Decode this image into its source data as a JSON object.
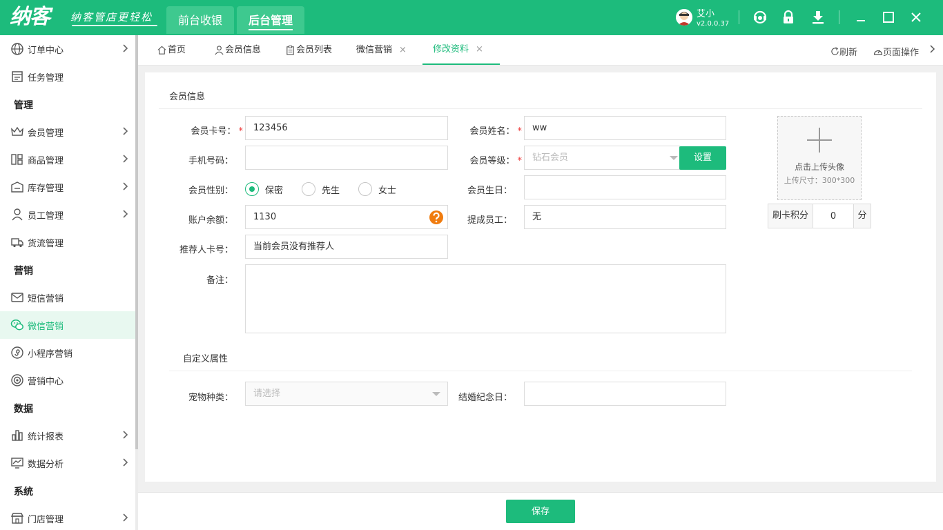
{
  "header": {
    "logo": "纳客",
    "slogan": "纳客管店更轻松",
    "tabs": [
      "前台收银",
      "后台管理"
    ],
    "user_name": "艾小",
    "version": "v2.0.0.37"
  },
  "sidebar": {
    "items": [
      {
        "label": "订单中心",
        "icon": "globe-icon",
        "arrow": true
      },
      {
        "label": "任务管理",
        "icon": "task-icon",
        "arrow": false
      },
      {
        "section": "管理"
      },
      {
        "label": "会员管理",
        "icon": "crown-icon",
        "arrow": true
      },
      {
        "label": "商品管理",
        "icon": "goods-icon",
        "arrow": true
      },
      {
        "label": "库存管理",
        "icon": "inventory-icon",
        "arrow": true
      },
      {
        "label": "员工管理",
        "icon": "person-icon",
        "arrow": true
      },
      {
        "label": "货流管理",
        "icon": "truck-icon",
        "arrow": false
      },
      {
        "section": "营销"
      },
      {
        "label": "短信营销",
        "icon": "mail-icon",
        "arrow": false
      },
      {
        "label": "微信营销",
        "icon": "wechat-icon",
        "arrow": false,
        "active": true
      },
      {
        "label": "小程序营销",
        "icon": "miniprogram-icon",
        "arrow": false
      },
      {
        "label": "营销中心",
        "icon": "target-icon",
        "arrow": false
      },
      {
        "section": "数据"
      },
      {
        "label": "统计报表",
        "icon": "bar-chart-icon",
        "arrow": true
      },
      {
        "label": "数据分析",
        "icon": "line-chart-icon",
        "arrow": true
      },
      {
        "section": "系统"
      },
      {
        "label": "门店管理",
        "icon": "store-icon",
        "arrow": true
      }
    ]
  },
  "tabs": {
    "items": [
      {
        "label": "首页",
        "icon": "home-icon"
      },
      {
        "label": "会员信息",
        "icon": "user-icon"
      },
      {
        "label": "会员列表",
        "icon": "clipboard-icon"
      },
      {
        "label": "微信营销",
        "close": "×"
      },
      {
        "label": "修改资料",
        "close": "×",
        "active": true
      }
    ],
    "refresh": "刷新",
    "page_ops": "页面操作"
  },
  "form": {
    "section_member": "会员信息",
    "card_no_label": "会员卡号：",
    "card_no_value": "123456",
    "name_label": "会员姓名：",
    "name_value": "ww",
    "phone_label": "手机号码：",
    "phone_value": "",
    "level_label": "会员等级：",
    "level_value": "钻石会员",
    "level_button": "设置",
    "gender_label": "会员性别：",
    "gender_options": [
      "保密",
      "先生",
      "女士"
    ],
    "gender_selected": "保密",
    "birthday_label": "会员生日：",
    "birthday_value": "",
    "balance_label": "账户余额：",
    "balance_value": "1130",
    "staff_label": "提成员工：",
    "staff_value": "无",
    "referrer_label": "推荐人卡号：",
    "referrer_value": "当前会员没有推荐人",
    "remark_label": "备注：",
    "remark_value": "",
    "required_mark": "*",
    "avatar_upload": "点击上传头像",
    "avatar_size": "上传尺寸：300*300",
    "points_label": "刷卡积分",
    "points_value": "0",
    "points_unit": "分",
    "section_custom": "自定义属性",
    "pet_label": "宠物种类：",
    "pet_placeholder": "请选择",
    "anniv_label": "结婚纪念日：",
    "anniv_value": ""
  },
  "footer": {
    "save_label": "保存"
  },
  "colors": {
    "accent": "#1dbb7c",
    "help": "#f07c0f",
    "required": "#e33333"
  }
}
